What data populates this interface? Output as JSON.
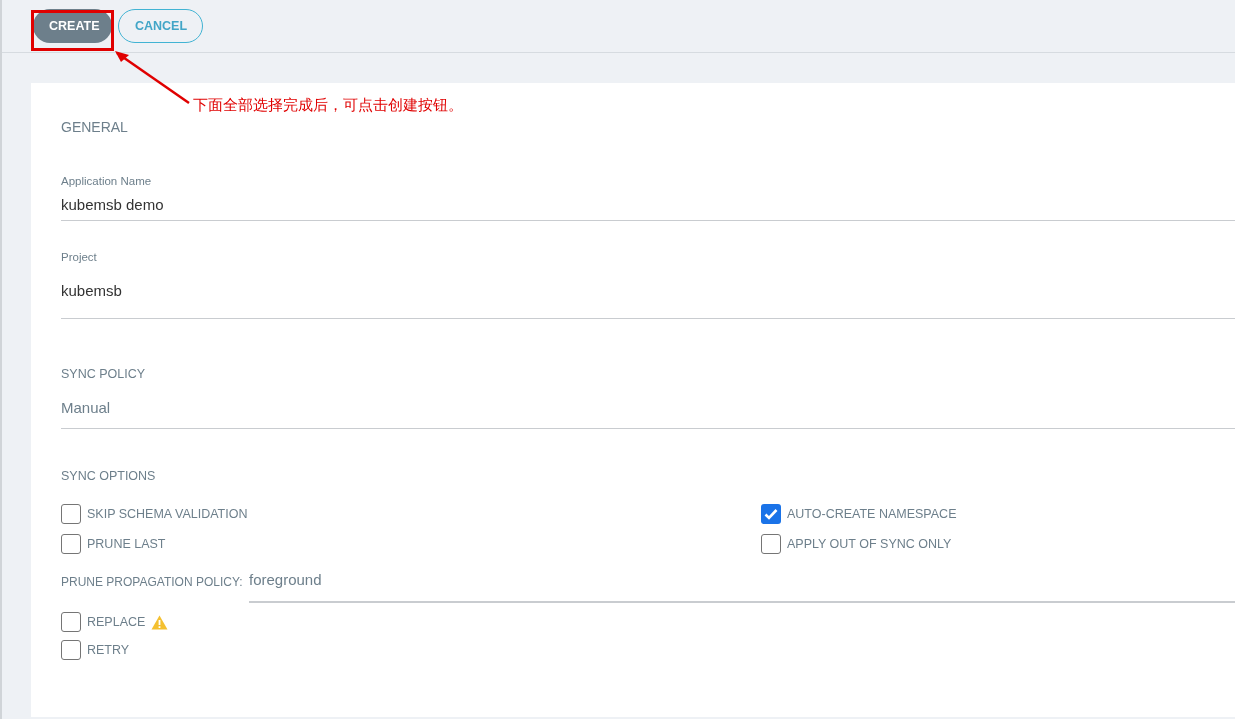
{
  "toolbar": {
    "buttons": [
      {
        "label": "CREATE",
        "kind": "primary"
      },
      {
        "label": "CANCEL",
        "kind": "outline"
      }
    ]
  },
  "annotation": {
    "text": "下面全部选择完成后，可点击创建按钮。"
  },
  "general": {
    "title": "GENERAL",
    "fields": [
      {
        "label": "Application Name",
        "value": "kubemsb demo"
      },
      {
        "label": "Project",
        "value": "kubemsb"
      }
    ]
  },
  "sync_policy": {
    "title": "SYNC POLICY",
    "value": "Manual"
  },
  "sync_options": {
    "title": "SYNC OPTIONS",
    "options": [
      {
        "label": "SKIP SCHEMA VALIDATION",
        "checked": false
      },
      {
        "label": "AUTO-CREATE NAMESPACE",
        "checked": true
      },
      {
        "label": "PRUNE LAST",
        "checked": false
      },
      {
        "label": "APPLY OUT OF SYNC ONLY",
        "checked": false
      }
    ],
    "propagation": {
      "label": "PRUNE PROPAGATION POLICY:",
      "value": "foreground"
    },
    "more_options": [
      {
        "label": "REPLACE",
        "checked": false,
        "warning": true
      },
      {
        "label": "RETRY",
        "checked": false,
        "warning": false
      }
    ]
  }
}
